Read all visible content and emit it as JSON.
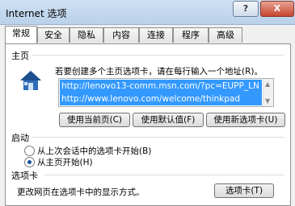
{
  "window": {
    "title": "Internet 选项",
    "help_label": "?",
    "close_label": "X"
  },
  "tabs": [
    "常规",
    "安全",
    "隐私",
    "内容",
    "连接",
    "程序",
    "高级"
  ],
  "homepage": {
    "section_label": "主页",
    "hint": "若要创建多个主页选项卡，请在每行输入一个地址(R)。",
    "urls": [
      "http://lenovo13-comm.msn.com/?pc=EUPP_LN",
      "http://www.lenovo.com/welcome/thinkpad"
    ],
    "buttons": {
      "current": "使用当前页(C)",
      "default": "使用默认值(F)",
      "new_tab": "使用新选项卡(U)"
    }
  },
  "startup": {
    "section_label": "启动",
    "options": [
      {
        "label": "从上次会话中的选项卡开始(B)",
        "selected": false
      },
      {
        "label": "从主页开始(H)",
        "selected": true
      }
    ]
  },
  "tabs_section": {
    "section_label": "选项卡",
    "desc": "更改网页在选项卡中的显示方式。",
    "button": "选项卡(T)"
  }
}
